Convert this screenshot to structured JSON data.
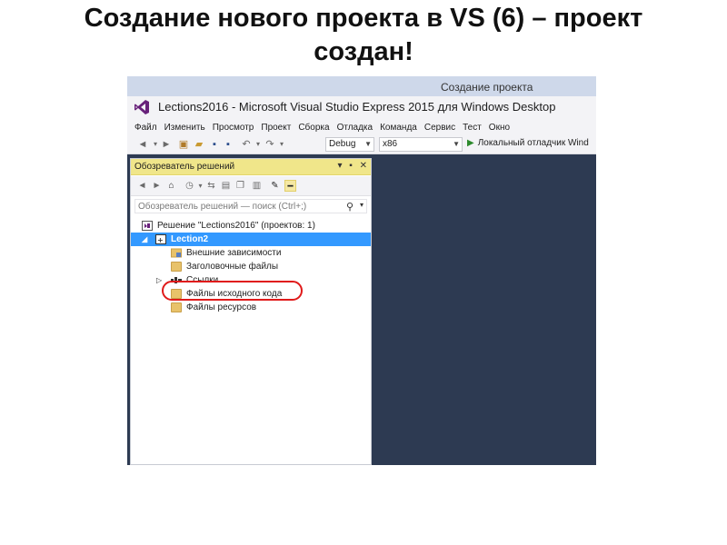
{
  "slide": {
    "title": "Создание нового проекта в VS (6) – проект создан!"
  },
  "dialog": {
    "title": "Создание проекта"
  },
  "window": {
    "title": "Lections2016 - Microsoft Visual Studio Express 2015 для Windows Desktop",
    "accent_color": "#68217a"
  },
  "menu": {
    "items": [
      "Файл",
      "Изменить",
      "Просмотр",
      "Проект",
      "Сборка",
      "Отладка",
      "Команда",
      "Сервис",
      "Тест",
      "Окно"
    ]
  },
  "toolbar": {
    "configuration": "Debug",
    "platform": "x86",
    "debugger_label": "Локальный отладчик Wind"
  },
  "solution_explorer": {
    "title": "Обозреватель решений",
    "header_buttons": [
      "▾",
      "▪",
      "✕"
    ],
    "search_placeholder": "Обозреватель решений — поиск (Ctrl+;)",
    "header_color": "#f0e68a",
    "selection_color": "#3399ff",
    "tree": [
      {
        "label": "Решение \"Lections2016\"  (проектов: 1)",
        "icon": "solution-icon",
        "expander": ""
      },
      {
        "label": "Lection2",
        "icon": "project-icon",
        "expander": "◢",
        "selected": true
      },
      {
        "label": "Внешние зависимости",
        "icon": "dependencies-icon",
        "expander": ""
      },
      {
        "label": "Заголовочные файлы",
        "icon": "folder-icon",
        "expander": ""
      },
      {
        "label": "Ссылки",
        "icon": "references-icon",
        "expander": "▷"
      },
      {
        "label": "Файлы исходного кода",
        "icon": "folder-icon",
        "expander": ""
      },
      {
        "label": "Файлы ресурсов",
        "icon": "folder-icon",
        "expander": ""
      }
    ]
  },
  "editor": {
    "background_color": "#2d3a52"
  }
}
